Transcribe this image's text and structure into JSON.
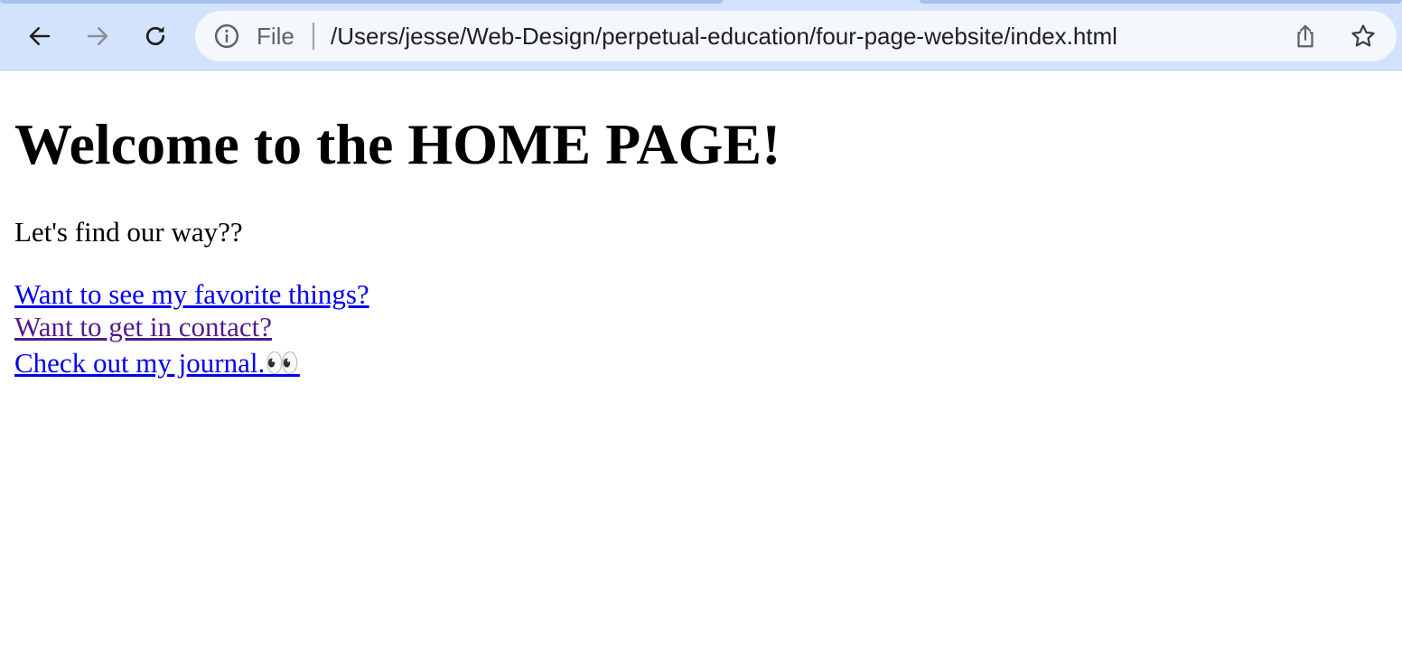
{
  "browser": {
    "icons": {
      "back": "back-arrow-icon",
      "forward": "forward-arrow-icon",
      "reload": "reload-icon",
      "info": "info-icon",
      "share": "share-icon",
      "bookmark": "star-icon"
    },
    "omnibox": {
      "scheme_label": "File",
      "url": "/Users/jesse/Web-Design/perpetual-education/four-page-website/index.html"
    },
    "colors": {
      "toolbar_background": "#d3e3fd",
      "omnibox_background": "#f4f7fc"
    }
  },
  "page": {
    "heading": "Welcome to the HOME PAGE!",
    "intro": "Let's find our way??",
    "links": [
      {
        "label": "Want to see my favorite things?",
        "state": "unvisited",
        "color": "#0000ee"
      },
      {
        "label": "Want to get in contact?",
        "state": "visited",
        "color": "#551a8b"
      },
      {
        "label": "Check out my journal.👀",
        "state": "unvisited",
        "color": "#0000ee"
      }
    ]
  }
}
